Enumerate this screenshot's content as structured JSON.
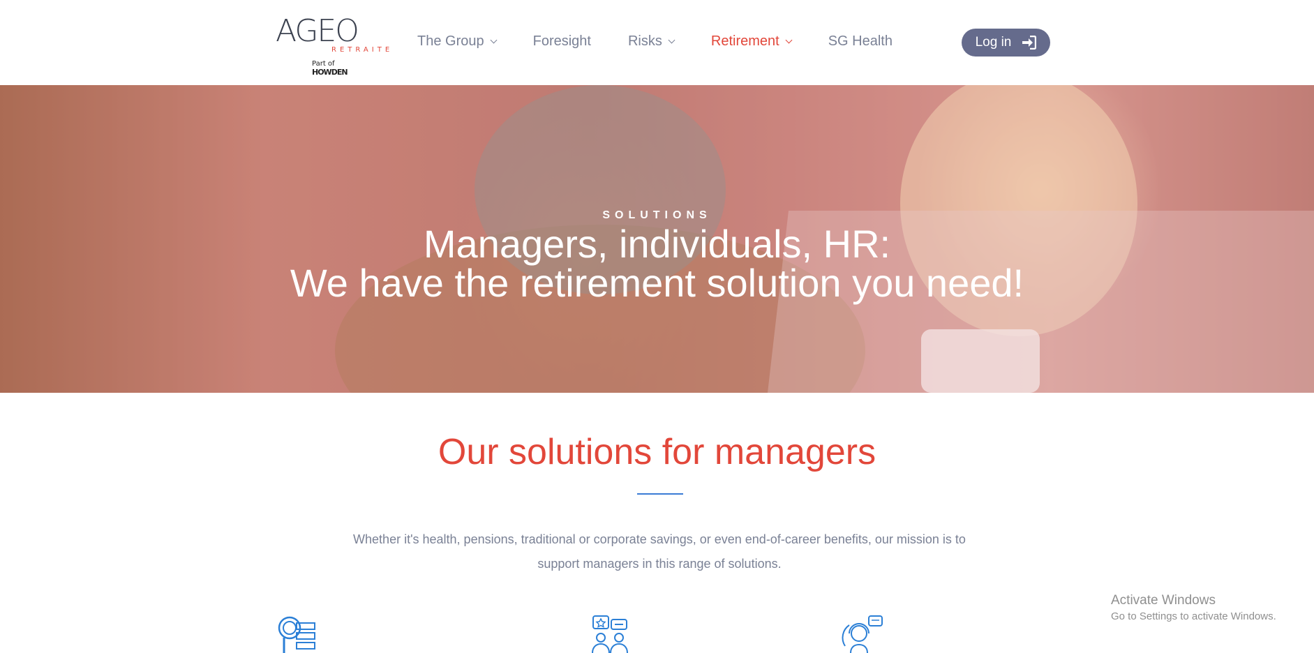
{
  "logo": {
    "brand": "AGEO",
    "subtitle": "RETRAITE",
    "part_of_prefix": "Part of",
    "part_of_brand": "HOWDEN"
  },
  "nav": {
    "items": [
      {
        "label": "The Group",
        "has_dropdown": true
      },
      {
        "label": "Foresight",
        "has_dropdown": false
      },
      {
        "label": "Risks",
        "has_dropdown": true
      },
      {
        "label": "Retirement",
        "has_dropdown": true,
        "active": true
      },
      {
        "label": "SG Health",
        "has_dropdown": false
      }
    ],
    "login_label": "Log in",
    "login_icon": "sign-in-icon"
  },
  "hero": {
    "kicker": "SOLUTIONS",
    "title_line1": "Managers, individuals, HR:",
    "title_line2": "We have the retirement solution you need!"
  },
  "section": {
    "title": "Our solutions for managers",
    "intro": "Whether it's health, pensions, traditional or corporate savings, or even end-of-career benefits, our mission is to support managers in this range of solutions."
  },
  "solution_icons": [
    "search-checklist-icon",
    "team-chat-icon",
    "support-agent-icon"
  ],
  "watermark": {
    "line1": "Activate Windows",
    "line2": "Go to Settings to activate Windows."
  },
  "colors": {
    "accent_red": "#e2473a",
    "nav_text": "#7a8195",
    "login_bg": "#656b8c",
    "divider_blue": "#3a7bd5",
    "icon_blue": "#2b7fd6"
  }
}
